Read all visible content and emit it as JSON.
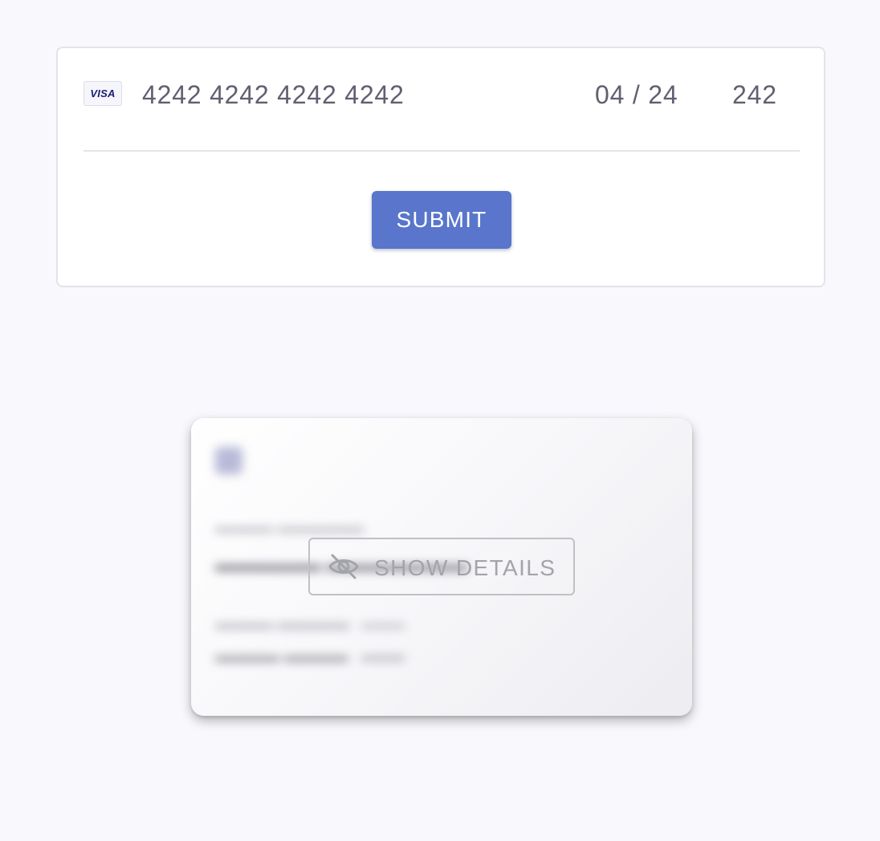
{
  "payment_form": {
    "brand": "VISA",
    "card_number": "4242 4242 4242 4242",
    "expiry": "04 / 24",
    "cvc": "242",
    "submit_label": "SUBMIT"
  },
  "card_preview": {
    "show_details_label": "SHOW DETAILS",
    "icon": "eye-off-icon"
  },
  "colors": {
    "background": "#f8f8fd",
    "submit_button": "#5976cc",
    "text": "#5f6070",
    "visa_blue": "#1a1f71"
  }
}
